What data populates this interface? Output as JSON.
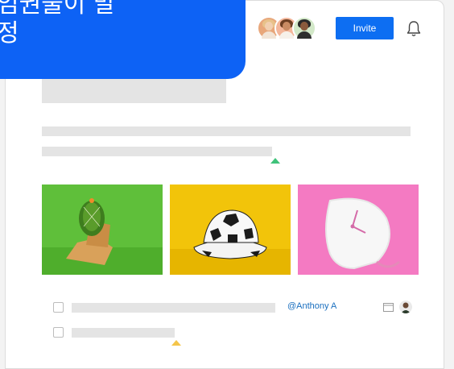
{
  "header": {
    "invite_label": "Invite",
    "avatars": [
      {
        "name": "collaborator-avatar-1",
        "bg": "#e8a77b",
        "hair": "#e8c28a",
        "face": "#f2cfb0",
        "body": "#f2e4d6"
      },
      {
        "name": "collaborator-avatar-2",
        "bg": "#f3b69a",
        "hair": "#6b3e22",
        "face": "#c98b63",
        "body": "#f6f1ea"
      },
      {
        "name": "collaborator-avatar-3",
        "bg": "#d2e8c8",
        "hair": "#2a2a2a",
        "face": "#8a5a3c",
        "body": "#2e2e2e"
      }
    ],
    "icons": {
      "bell": "bell-icon"
    }
  },
  "toast": {
    "text": "임권물이 말\n정"
  },
  "gallery": [
    {
      "name": "image-cactus",
      "bg": "#5fbf3a"
    },
    {
      "name": "image-soccer-hat",
      "bg": "#f2c40a"
    },
    {
      "name": "image-melting-clock",
      "bg": "#f47ac2"
    }
  ],
  "tasks": {
    "assignee_mention": "@Anthony A"
  },
  "colors": {
    "accent": "#0d6ef2",
    "green_caret": "#3fc27a",
    "yellow_caret": "#f4c54a",
    "placeholder": "#e4e4e4"
  }
}
